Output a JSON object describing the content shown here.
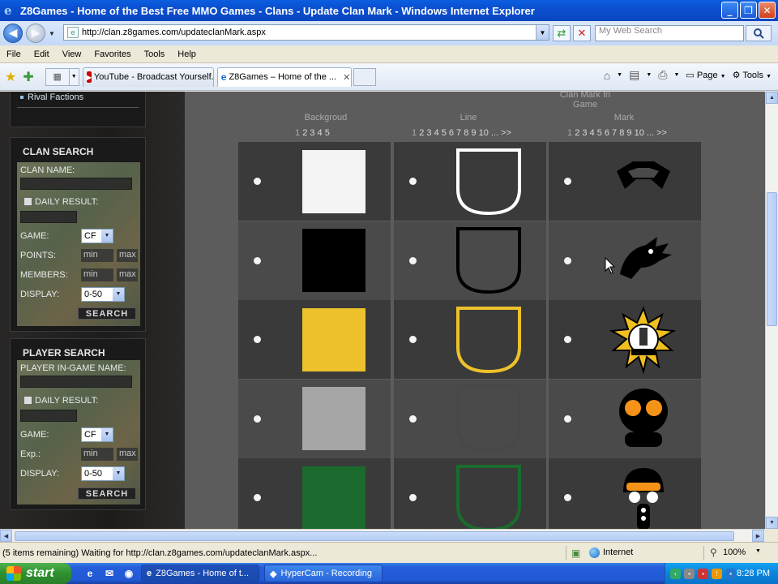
{
  "window": {
    "title": "Z8Games - Home of the Best Free MMO Games - Clans - Update Clan Mark - Windows Internet Explorer",
    "min_label": "_",
    "max_label": "❐",
    "close_label": "✕"
  },
  "address": {
    "url": "http://clan.z8games.com/updateclanMark.aspx",
    "search_placeholder": "My Web Search"
  },
  "menu": [
    "File",
    "Edit",
    "View",
    "Favorites",
    "Tools",
    "Help"
  ],
  "tabs": [
    {
      "label": "YouTube - Broadcast Yourself.",
      "icon": "youtube-icon"
    },
    {
      "label": "Z8Games – Home of the ...",
      "icon": "ie-icon",
      "active": true
    }
  ],
  "commandbar": {
    "page_label": "Page",
    "tools_label": "Tools"
  },
  "sidebar": {
    "rival_link": "Rival Factions",
    "clan_search": {
      "title": "CLAN SEARCH",
      "clan_name_label": "CLAN NAME:",
      "daily_result_label": "DAILY RESULT:",
      "game_label": "GAME:",
      "game_value": "CF",
      "points_label": "POINTS:",
      "members_label": "MEMBERS:",
      "min_placeholder": "min",
      "max_placeholder": "max",
      "display_label": "DISPLAY:",
      "display_value": "0-50",
      "search_button": "SEARCH"
    },
    "player_search": {
      "title": "PLAYER SEARCH",
      "name_label": "PLAYER IN-GAME NAME:",
      "daily_result_label": "DAILY RESULT:",
      "game_label": "GAME:",
      "game_value": "CF",
      "exp_label": "Exp.:",
      "min_placeholder": "min",
      "max_placeholder": "max",
      "display_label": "DISPLAY:",
      "display_value": "0-50",
      "search_button": "SEARCH"
    }
  },
  "grid": {
    "clan_mark_title": "Clan Mark In Game",
    "background_header": "Backgroud",
    "line_header": "Line",
    "mark_header": "Mark",
    "background_pager": {
      "current": "1",
      "pages": "2 3 4 5"
    },
    "line_pager": {
      "current": "1",
      "pages": "2 3 4 5 6 7 8 9 10 ... >>"
    },
    "mark_pager": {
      "current": "1",
      "pages": "2 3 4 5 6 7 8 9 10 ... >>"
    },
    "background_colors": [
      "#f4f4f4",
      "#000000",
      "#ecc12b",
      "#a5a5a5",
      "#1b6b2e"
    ],
    "line_colors": [
      "#ffffff",
      "#000000",
      "#ecc12b",
      "#484848",
      "#1b6b2e"
    ],
    "marks": [
      "goggles-mark-icon",
      "eagle-mark-icon",
      "sun-emblem-mark-icon",
      "gasmask-mark-icon",
      "helmet-gasmask-mark-icon"
    ]
  },
  "status": {
    "text": "(5 items remaining) Waiting for http://clan.z8games.com/updateclanMark.aspx...",
    "zone": "Internet",
    "zoom": "100%"
  },
  "taskbar": {
    "start": "start",
    "tasks": [
      {
        "label": "Z8Games - Home of t...",
        "icon": "ie-icon"
      },
      {
        "label": "HyperCam - Recording",
        "icon": "hypercam-icon"
      }
    ],
    "clock": "8:28 PM"
  }
}
